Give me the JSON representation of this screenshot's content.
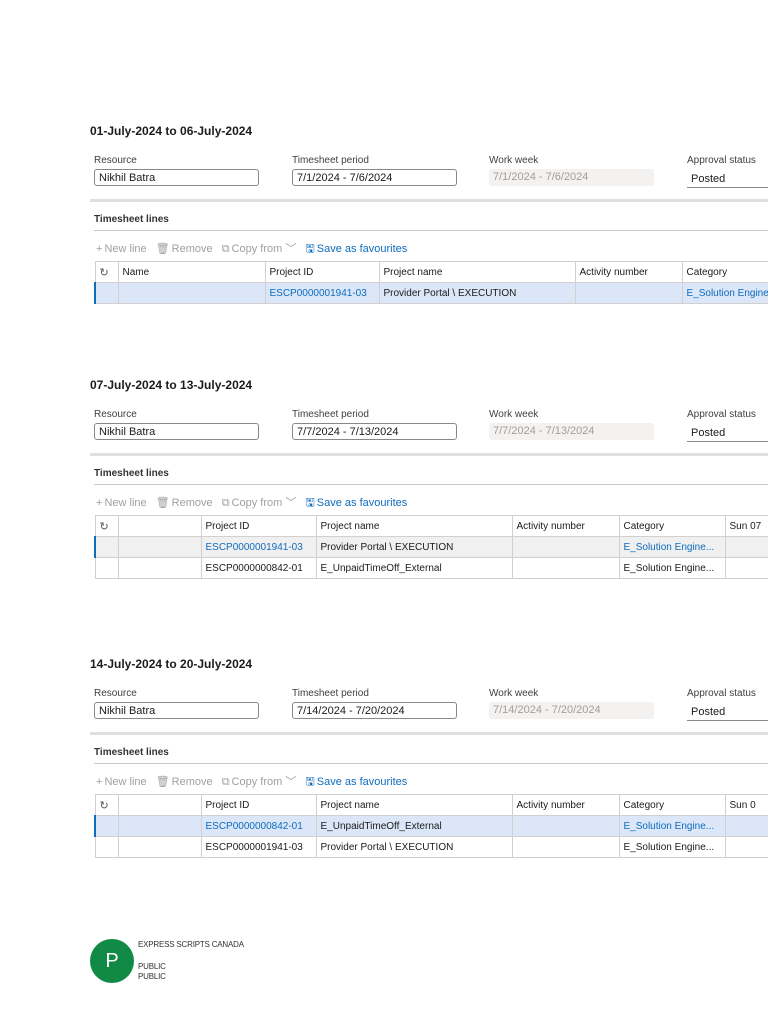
{
  "weeks": [
    {
      "title": "01-July-2024 to 06-July-2024",
      "resource_label": "Resource",
      "resource_value": "Nikhil Batra",
      "period_label": "Timesheet period",
      "period_value": "7/1/2024 - 7/6/2024",
      "workweek_label": "Work week",
      "workweek_value": "7/1/2024 - 7/6/2024",
      "approval_label": "Approval status",
      "approval_value": "Posted",
      "lines_title": "Timesheet lines",
      "toolbar": {
        "new_line": "New line",
        "remove": "Remove",
        "copy_from": "Copy from",
        "save_favourites": "Save as favourites"
      },
      "columns": [
        "",
        "Name",
        "Project ID",
        "Project name",
        "Activity number",
        "Category"
      ],
      "rows": [
        [
          "",
          "",
          "ESCP0000001941-03",
          "Provider Portal \\ EXECUTION",
          "",
          "E_Solution Engine..."
        ]
      ]
    },
    {
      "title": "07-July-2024 to 13-July-2024",
      "resource_label": "Resource",
      "resource_value": "Nikhil Batra",
      "period_label": "Timesheet period",
      "period_value": "7/7/2024 - 7/13/2024",
      "workweek_label": "Work week",
      "workweek_value": "7/7/2024 - 7/13/2024",
      "approval_label": "Approval status",
      "approval_value": "Posted",
      "lines_title": "Timesheet lines",
      "toolbar": {
        "new_line": "New line",
        "remove": "Remove",
        "copy_from": "Copy from",
        "save_favourites": "Save as favourites"
      },
      "columns": [
        "",
        "",
        "Project ID",
        "Project name",
        "Activity number",
        "Category",
        "Sun 07"
      ],
      "rows": [
        [
          "",
          "",
          "ESCP0000001941-03",
          "Provider Portal \\ EXECUTION",
          "",
          "E_Solution Engine...",
          ""
        ],
        [
          "",
          "",
          "ESCP0000000842-01",
          "E_UnpaidTimeOff_External",
          "",
          "E_Solution Engine...",
          ""
        ]
      ]
    },
    {
      "title": "14-July-2024 to 20-July-2024",
      "resource_label": "Resource",
      "resource_value": "Nikhil Batra",
      "period_label": "Timesheet period",
      "period_value": "7/14/2024 - 7/20/2024",
      "workweek_label": "Work week",
      "workweek_value": "7/14/2024 - 7/20/2024",
      "approval_label": "Approval status",
      "approval_value": "Posted",
      "lines_title": "Timesheet lines",
      "toolbar": {
        "new_line": "New line",
        "remove": "Remove",
        "copy_from": "Copy from",
        "save_favourites": "Save as favourites"
      },
      "columns": [
        "",
        "",
        "Project ID",
        "Project name",
        "Activity number",
        "Category",
        "Sun 0"
      ],
      "rows": [
        [
          "",
          "",
          "ESCP0000000842-01",
          "E_UnpaidTimeOff_External",
          "",
          "E_Solution Engine...",
          ""
        ],
        [
          "",
          "",
          "ESCP0000001941-03",
          "Provider Portal \\ EXECUTION",
          "",
          "E_Solution Engine...",
          ""
        ]
      ]
    }
  ],
  "footer": {
    "logo_letter": "P",
    "company": "EXPRESS SCRIPTS CANADA",
    "class1": "PUBLIC",
    "class2": "PUBLIC",
    "logo_color": "#108a44"
  },
  "colors": {
    "link": "#0f6cbd",
    "selected_row": "#dbe7f8"
  },
  "icons": {
    "refresh": "refresh-icon",
    "add": "plus-icon",
    "remove": "trash-icon",
    "copy": "copy-icon",
    "save": "save-icon",
    "chevron": "chevron-down-icon"
  }
}
